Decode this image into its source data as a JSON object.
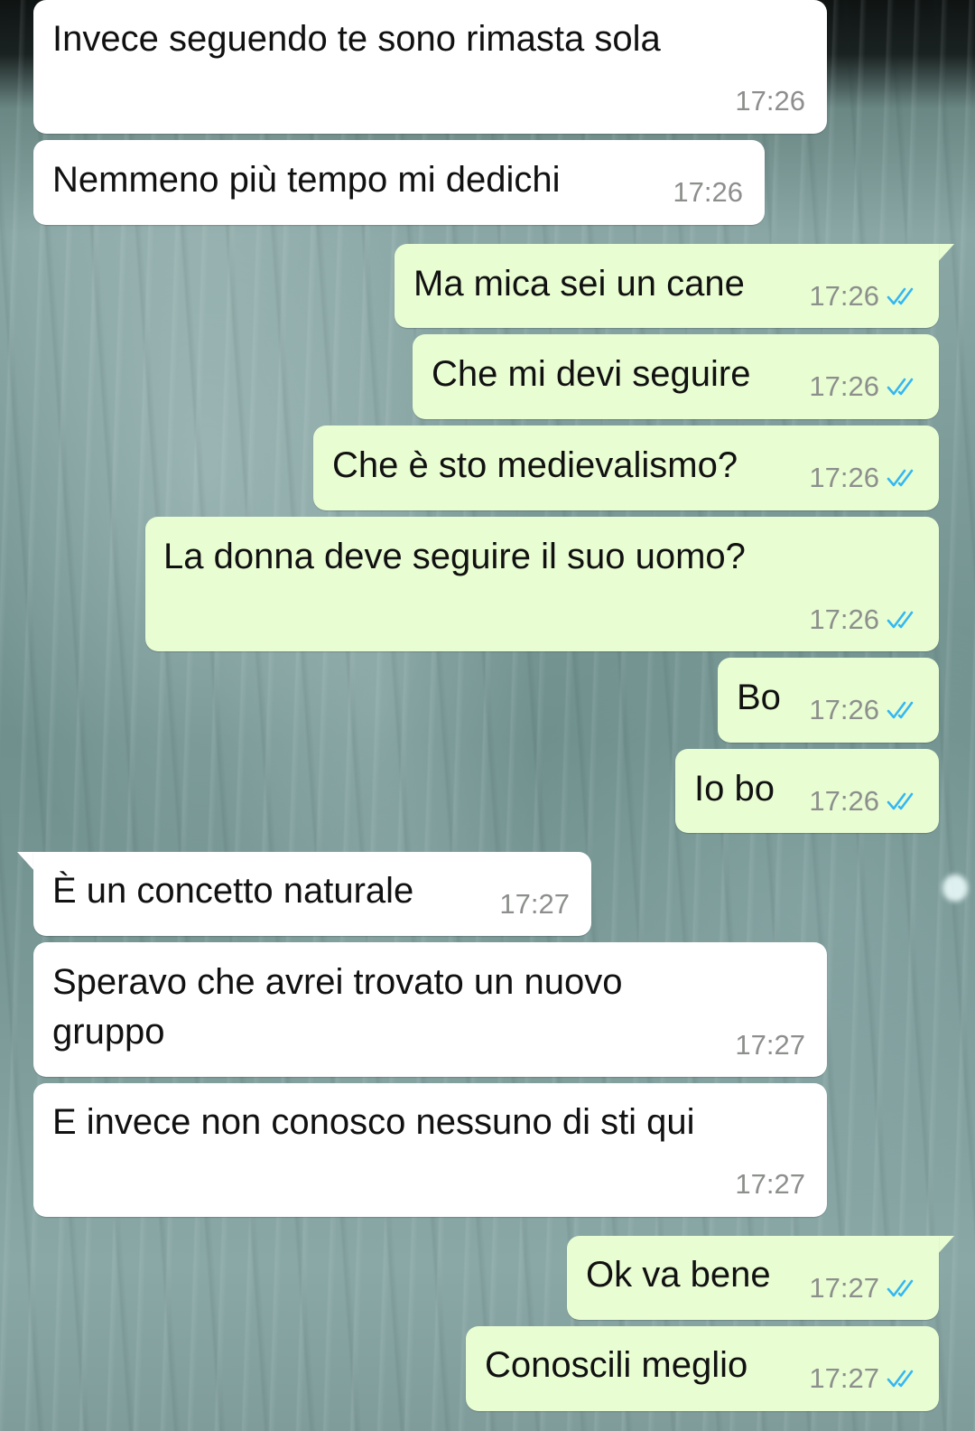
{
  "messages": [
    {
      "direction": "incoming",
      "text": "Invece seguendo te sono rimasta sola",
      "time": "17:26"
    },
    {
      "direction": "incoming",
      "text": "Nemmeno più tempo mi dedichi",
      "time": "17:26"
    },
    {
      "direction": "outgoing",
      "text": "Ma mica sei un cane",
      "time": "17:26",
      "status": "read"
    },
    {
      "direction": "outgoing",
      "text": "Che mi devi seguire",
      "time": "17:26",
      "status": "read"
    },
    {
      "direction": "outgoing",
      "text": "Che è sto medievalismo?",
      "time": "17:26",
      "status": "read"
    },
    {
      "direction": "outgoing",
      "text": "La donna deve seguire il suo uomo?",
      "time": "17:26",
      "status": "read"
    },
    {
      "direction": "outgoing",
      "text": "Bo",
      "time": "17:26",
      "status": "read"
    },
    {
      "direction": "outgoing",
      "text": "Io bo",
      "time": "17:26",
      "status": "read"
    },
    {
      "direction": "incoming",
      "text": "È un concetto naturale",
      "time": "17:27"
    },
    {
      "direction": "incoming",
      "text": "Speravo che avrei trovato un nuovo\ngruppo",
      "time": "17:27"
    },
    {
      "direction": "incoming",
      "text": "E invece non conosco nessuno di sti qui",
      "time": "17:27"
    },
    {
      "direction": "outgoing",
      "text": "Ok va bene",
      "time": "17:27",
      "status": "read"
    },
    {
      "direction": "outgoing",
      "text": "Conoscili meglio",
      "time": "17:27",
      "status": "read"
    }
  ],
  "colors": {
    "incoming_bubble": "#ffffff",
    "outgoing_bubble": "#e9fdd3",
    "read_tick": "#34b7f1",
    "timestamp": "#8c8f8c"
  },
  "icons": {
    "read_receipt": "double-check-icon"
  }
}
